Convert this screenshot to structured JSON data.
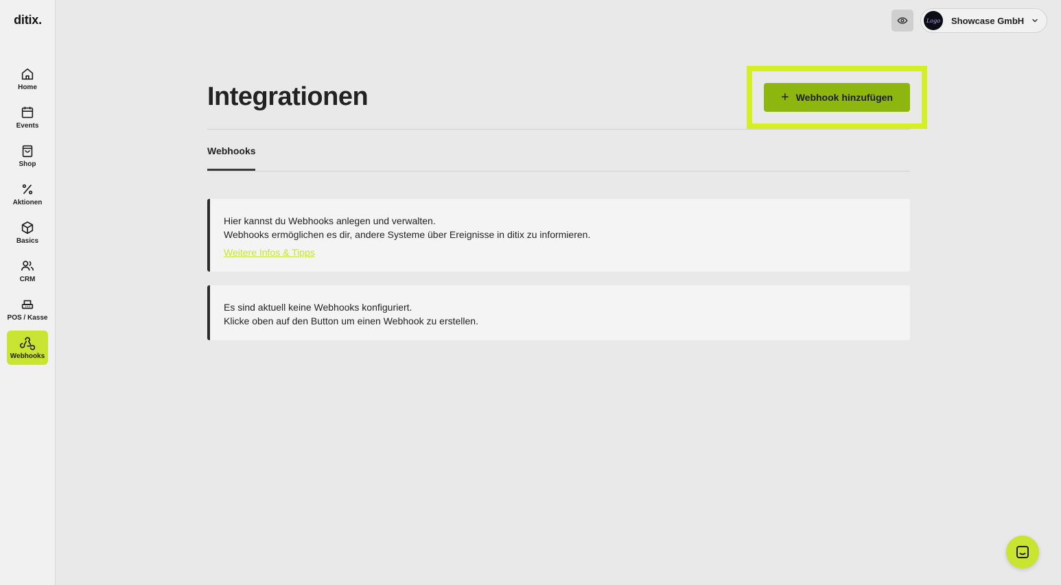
{
  "app": {
    "logo": "ditix."
  },
  "sidebar": {
    "items": [
      {
        "label": "Home",
        "icon": "home-icon"
      },
      {
        "label": "Events",
        "icon": "calendar-icon"
      },
      {
        "label": "Shop",
        "icon": "shopping-bag-icon"
      },
      {
        "label": "Aktionen",
        "icon": "percent-icon"
      },
      {
        "label": "Basics",
        "icon": "box-icon"
      },
      {
        "label": "CRM",
        "icon": "users-icon"
      },
      {
        "label": "POS / Kasse",
        "icon": "pos-terminal-icon"
      },
      {
        "label": "Webhooks",
        "icon": "webhook-icon",
        "active": true
      }
    ]
  },
  "topbar": {
    "preview_icon": "eye-icon",
    "account": {
      "avatar_text": "Logo",
      "name": "Showcase GmbH"
    }
  },
  "page": {
    "title": "Integrationen",
    "add_button_label": "Webhook hinzufügen",
    "tabs": [
      {
        "label": "Webhooks",
        "active": true
      }
    ]
  },
  "info_card": {
    "line1": "Hier kannst du Webhooks anlegen und verwalten.",
    "line2": "Webhooks ermöglichen es dir, andere Systeme über Ereignisse in ditix zu informieren.",
    "link": "Weitere Infos & Tipps"
  },
  "empty_card": {
    "line1": "Es sind aktuell keine Webhooks konfiguriert.",
    "line2": "Klicke oben auf den Button um einen Webhook zu erstellen."
  },
  "colors": {
    "accent": "#c9e431",
    "button": "#8db60f",
    "highlight": "#d4ef24"
  }
}
